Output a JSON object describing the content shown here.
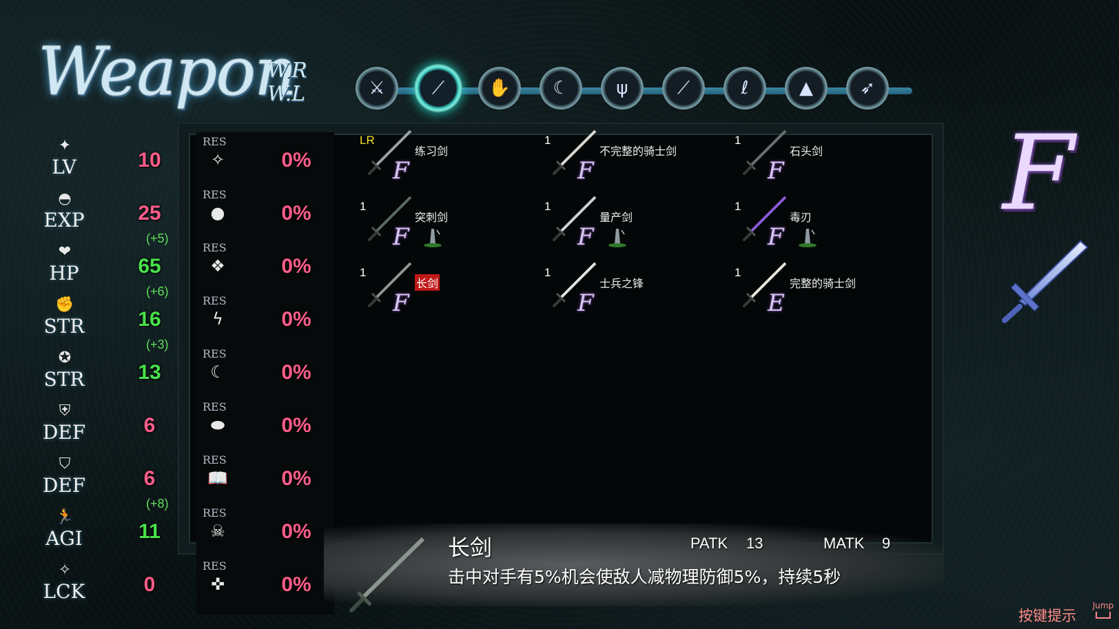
{
  "header": {
    "title": "Weapon",
    "sub_right": "W.R",
    "sub_left": "W.L"
  },
  "tabs": [
    {
      "name": "tab-crossed-swords",
      "icon": "crossed-swords-icon",
      "glyph": "⚔"
    },
    {
      "name": "tab-sword",
      "icon": "sword-icon",
      "glyph": "⟋",
      "active": true
    },
    {
      "name": "tab-gauntlet",
      "icon": "gauntlet-icon",
      "glyph": "✋"
    },
    {
      "name": "tab-scythe",
      "icon": "scythe-icon",
      "glyph": "☾"
    },
    {
      "name": "tab-claws",
      "icon": "claws-icon",
      "glyph": "ψ"
    },
    {
      "name": "tab-spear",
      "icon": "spear-icon",
      "glyph": "⟋"
    },
    {
      "name": "tab-whip",
      "icon": "whip-icon",
      "glyph": "ℓ"
    },
    {
      "name": "tab-boot",
      "icon": "boot-icon",
      "glyph": "▲"
    },
    {
      "name": "tab-bow",
      "icon": "bow-icon",
      "glyph": "➶"
    }
  ],
  "stats": [
    {
      "icon": "star-blade-icon",
      "glyph": "✦",
      "label": "LV",
      "value": "10",
      "bonus": "",
      "boost": false,
      "res_label": "RES",
      "res_icon": "blade-wing-icon",
      "res_glyph": "✧",
      "res_value": "0%"
    },
    {
      "icon": "leaf-orb-icon",
      "glyph": "◓",
      "label": "EXP",
      "value": "25",
      "bonus": "",
      "boost": false,
      "res_label": "RES",
      "res_icon": "fire-orb-icon",
      "res_glyph": "●",
      "res_value": "0%"
    },
    {
      "icon": "heart-icon",
      "glyph": "❤",
      "label": "HP",
      "value": "65",
      "bonus": "(+5)",
      "boost": true,
      "res_label": "RES",
      "res_icon": "ice-cube-icon",
      "res_glyph": "❖",
      "res_value": "0%"
    },
    {
      "icon": "fist-icon",
      "glyph": "✊",
      "label": "STR",
      "value": "16",
      "bonus": "(+6)",
      "boost": true,
      "res_label": "RES",
      "res_icon": "lightning-icon",
      "res_glyph": "ϟ",
      "res_value": "0%"
    },
    {
      "icon": "magic-star-icon",
      "glyph": "✪",
      "label": "STR",
      "value": "13",
      "bonus": "(+3)",
      "boost": true,
      "res_label": "RES",
      "res_icon": "crescent-icon",
      "res_glyph": "☾",
      "res_value": "0%"
    },
    {
      "icon": "shield-sword-icon",
      "glyph": "⛨",
      "label": "DEF",
      "value": "6",
      "bonus": "",
      "boost": false,
      "res_label": "RES",
      "res_icon": "rock-icon",
      "res_glyph": "⬬",
      "res_value": "0%"
    },
    {
      "icon": "shield-icon",
      "glyph": "⛉",
      "label": "DEF",
      "value": "6",
      "bonus": "",
      "boost": false,
      "res_label": "RES",
      "res_icon": "book-icon",
      "res_glyph": "📖",
      "res_value": "0%"
    },
    {
      "icon": "running-icon",
      "glyph": "🏃",
      "label": "AGI",
      "value": "11",
      "bonus": "(+8)",
      "boost": true,
      "res_label": "RES",
      "res_icon": "skull-icon",
      "res_glyph": "☠",
      "res_value": "0%"
    },
    {
      "icon": "sparkle-icon",
      "glyph": "✧",
      "label": "LCK",
      "value": "0",
      "bonus": "",
      "boost": false,
      "res_label": "RES",
      "res_icon": "holy-emblem-icon",
      "res_glyph": "✜",
      "res_value": "0%"
    }
  ],
  "weapons": [
    {
      "count": "LR",
      "name": "练习剑",
      "rank": "F",
      "gem": false,
      "selected": false,
      "color": "#9aa0a6"
    },
    {
      "count": "1",
      "name": "不完整的骑士剑",
      "rank": "F",
      "gem": false,
      "selected": false,
      "color": "#d9d9d0"
    },
    {
      "count": "1",
      "name": "石头剑",
      "rank": "F",
      "gem": false,
      "selected": false,
      "color": "#6b6f72"
    },
    {
      "count": "1",
      "name": "突刺剑",
      "rank": "F",
      "gem": true,
      "selected": false,
      "color": "#5b6b62"
    },
    {
      "count": "1",
      "name": "量产剑",
      "rank": "F",
      "gem": true,
      "selected": false,
      "color": "#cfd2d4"
    },
    {
      "count": "1",
      "name": "毒刃",
      "rank": "F",
      "gem": true,
      "selected": false,
      "color": "#8a5bd0"
    },
    {
      "count": "1",
      "name": "长剑",
      "rank": "F",
      "gem": false,
      "selected": true,
      "color": "#8c9490"
    },
    {
      "count": "1",
      "name": "士兵之锋",
      "rank": "F",
      "gem": false,
      "selected": false,
      "color": "#e2e2dc"
    },
    {
      "count": "1",
      "name": "完整的骑士剑",
      "rank": "E",
      "gem": false,
      "selected": false,
      "color": "#e8e8e0"
    }
  ],
  "side": {
    "rank": "F"
  },
  "detail": {
    "name": "长剑",
    "patk_label": "PATK",
    "patk_value": "13",
    "matk_label": "MATK",
    "matk_value": "9",
    "description": "击中对手有5%机会使敌人减物理防御5%，持续5秒"
  },
  "hint": {
    "label": "按键提示",
    "key": "Jump"
  }
}
